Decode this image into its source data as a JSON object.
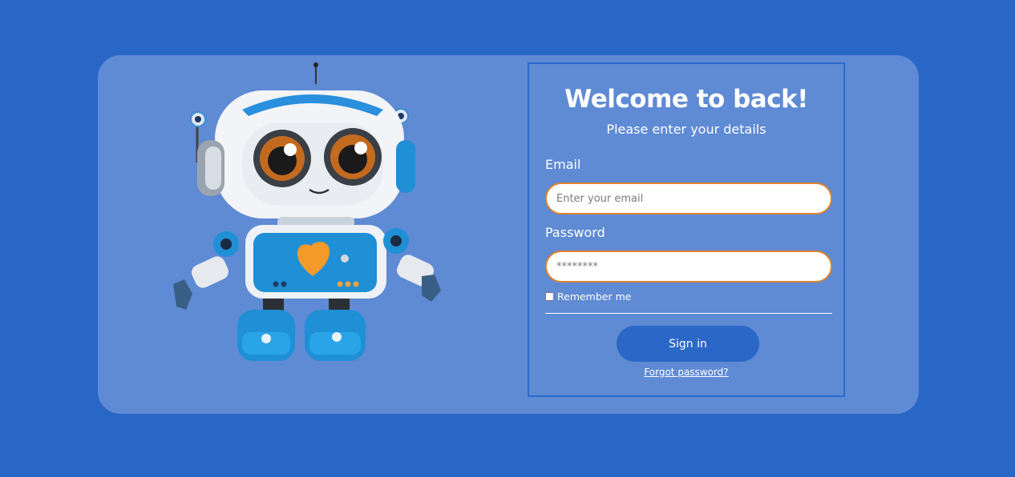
{
  "login": {
    "title": "Welcome to back!",
    "subtitle": "Please enter your details",
    "email_label": "Email",
    "email_placeholder": "Enter your email",
    "email_value": "",
    "password_label": "Password",
    "password_placeholder": "********",
    "password_value": "",
    "remember_label": "Remember me",
    "remember_checked": false,
    "signin_label": "Sign in",
    "forgot_label": "Forgot password?"
  },
  "illustration": {
    "name": "robot-mascot-illustration",
    "heart_icon": "heart-icon"
  },
  "colors": {
    "page_background": "#2967c6",
    "card_background": "#5f8ad4",
    "input_border": "#e0832a",
    "button_background": "#2a67c7",
    "text": "#ffffff"
  }
}
